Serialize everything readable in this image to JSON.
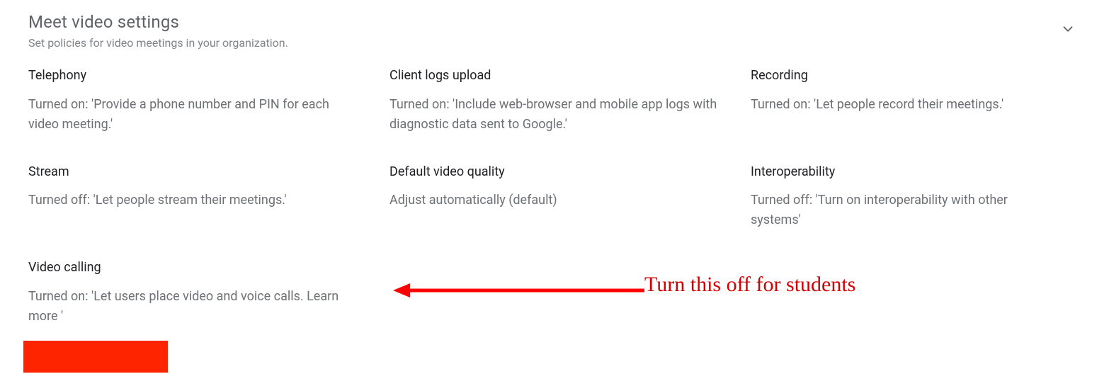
{
  "header": {
    "title": "Meet video settings",
    "subtitle": "Set policies for video meetings in your organization."
  },
  "settings": {
    "telephony": {
      "title": "Telephony",
      "desc": "Turned on: 'Provide a phone number and PIN for each video meeting.'"
    },
    "client_logs": {
      "title": "Client logs upload",
      "desc": "Turned on: 'Include web-browser and mobile app logs with diagnostic data sent to Google.'"
    },
    "recording": {
      "title": "Recording",
      "desc": "Turned on: 'Let people record their meetings.'"
    },
    "stream": {
      "title": "Stream",
      "desc": "Turned off: 'Let people stream their meetings.'"
    },
    "video_quality": {
      "title": "Default video quality",
      "desc": "Adjust automatically (default)"
    },
    "interop": {
      "title": "Interoperability",
      "desc": "Turned off: 'Turn on interoperability with other systems'"
    },
    "video_calling": {
      "title": "Video calling",
      "desc": "Turned on: 'Let users place video and voice calls. Learn more '"
    }
  },
  "annotation": {
    "text": "Turn this off for students"
  }
}
